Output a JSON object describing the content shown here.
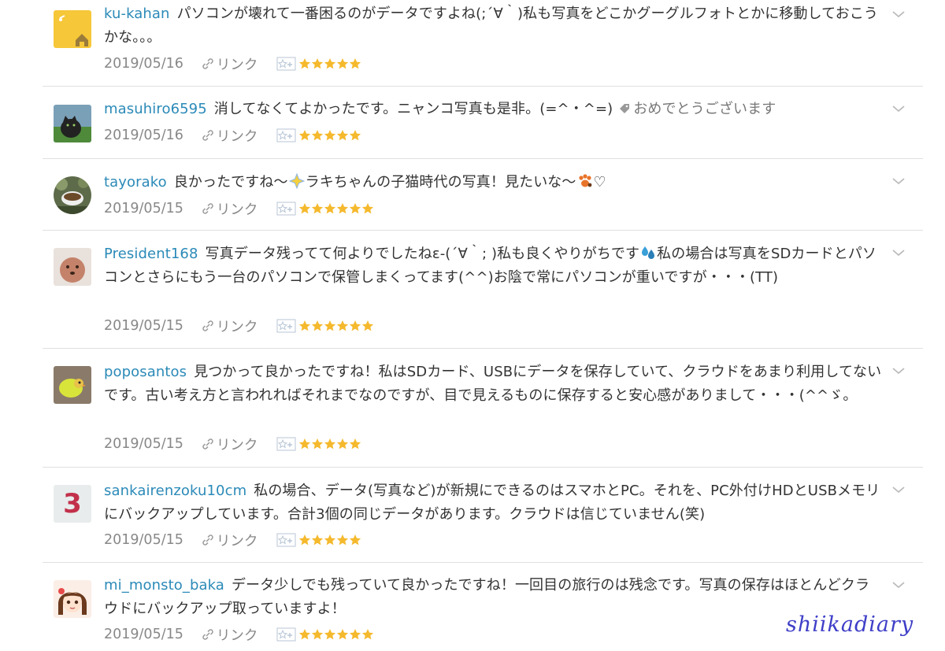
{
  "link_label": "リンク",
  "star_color": "#f5b92d",
  "username_color": "#2b8ab8",
  "watermark": "shiikadiary",
  "comments": [
    {
      "avatar": "house-logo-avatar",
      "username": "ku-kahan",
      "text_parts": [
        "パソコンが壊れて一番困るのがデータですよね(;´∀｀)私も写真をどこかグーグルフォトとかに移動しておこうかな。。。"
      ],
      "date": "2019/05/16",
      "stars": 5
    },
    {
      "avatar": "cat-photo-avatar",
      "username": "masuhiro6595",
      "text_parts": [
        "消してなくてよかったです。ニャンコ写真も是非。(=^・^=)"
      ],
      "tag": "おめでとうございます",
      "date": "2019/05/16",
      "stars": 5
    },
    {
      "avatar": "cup-photo-avatar",
      "username": "tayorako",
      "text_parts": [
        "良かったですね〜",
        "ラキちゃんの子猫時代の写真！見たいな〜",
        "♡"
      ],
      "emojis": [
        "sparkle-emoji",
        "paw-emoji"
      ],
      "date": "2019/05/15",
      "stars": 6
    },
    {
      "avatar": "dog-photo-avatar",
      "username": "President168",
      "text_parts": [
        "写真データ残ってて何よりでしたねε-(´∀｀; )私も良くやりがちです",
        "私の場合は写真をSDカードとパソコンとさらにもう一台のパソコンで保管しまくってます(^^)お陰で常にパソコンが重いですが・・・(TT)"
      ],
      "emojis": [
        "sweat-emoji"
      ],
      "date": "2019/05/15",
      "stars": 6
    },
    {
      "avatar": "bird-photo-avatar",
      "username": "poposantos",
      "text_parts": [
        "見つかって良かったですね！私はSDカード、USBにデータを保存していて、クラウドをあまり利用してないです。古い考え方と言われればそれまでなのですが、目で見えるものに保存すると安心感がありまして・・・(^^ゞ。"
      ],
      "date": "2019/05/15",
      "stars": 5
    },
    {
      "avatar": "number-three-avatar",
      "avatar_text": "3",
      "username": "sankairenzoku10cm",
      "text_parts": [
        "私の場合、データ(写真など)が新規にできるのはスマホとPC。それを、PC外付けHDとUSBメモリにバックアップしています。合計3個の同じデータがあります。クラウドは信じていません(笑)"
      ],
      "date": "2019/05/15",
      "stars": 5
    },
    {
      "avatar": "anime-girl-avatar",
      "username": "mi_monsto_baka",
      "text_parts": [
        "データ少しでも残っていて良かったですね！一回目の旅行のは残念です。写真の保存はほとんどクラウドにバックアップ取っていますよ！"
      ],
      "date": "2019/05/15",
      "stars": 6
    }
  ]
}
